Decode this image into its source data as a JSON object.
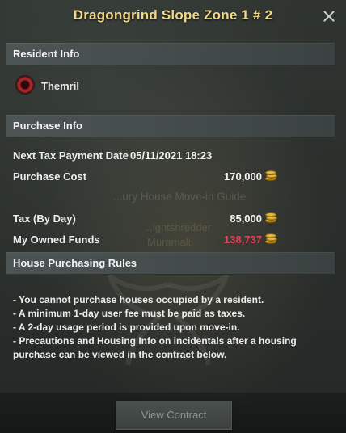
{
  "window": {
    "title": "Dragongrind Slope Zone 1 # 2"
  },
  "background_text": {
    "scene_title": "...ury House Move-in Guide",
    "gold_text": "...ightshredder",
    "name_text": "Muramaki"
  },
  "resident_info": {
    "header": "Resident Info",
    "resident_name": "Themril"
  },
  "purchase_info": {
    "header": "Purchase Info",
    "next_tax_label": "Next Tax Payment Date",
    "next_tax_value": "05/11/2021 18:23",
    "purchase_cost_label": "Purchase Cost",
    "purchase_cost_value": "170,000",
    "tax_label": "Tax (By Day)",
    "tax_value": "85,000",
    "funds_label": "My Owned Funds",
    "funds_value": "138,737"
  },
  "rules": {
    "header": "House Purchasing Rules",
    "lines": [
      "- You cannot purchase houses occupied by a resident.",
      "- A minimum 1-day user fee must be paid as taxes.",
      "- A 2-day usage period is provided upon move-in.",
      "- Precautions and Housing Info on incidentals after a housing purchase can be viewed in the contract below."
    ]
  },
  "footer": {
    "view_contract_label": "View Contract"
  },
  "colors": {
    "title": "#f0d98a",
    "insufficient_funds": "#e0405a",
    "coin": "#e6b93a"
  },
  "icons": {
    "close": "close-icon",
    "currency": "gold-coin-icon",
    "resident_avatar": "guild-emblem-icon"
  }
}
